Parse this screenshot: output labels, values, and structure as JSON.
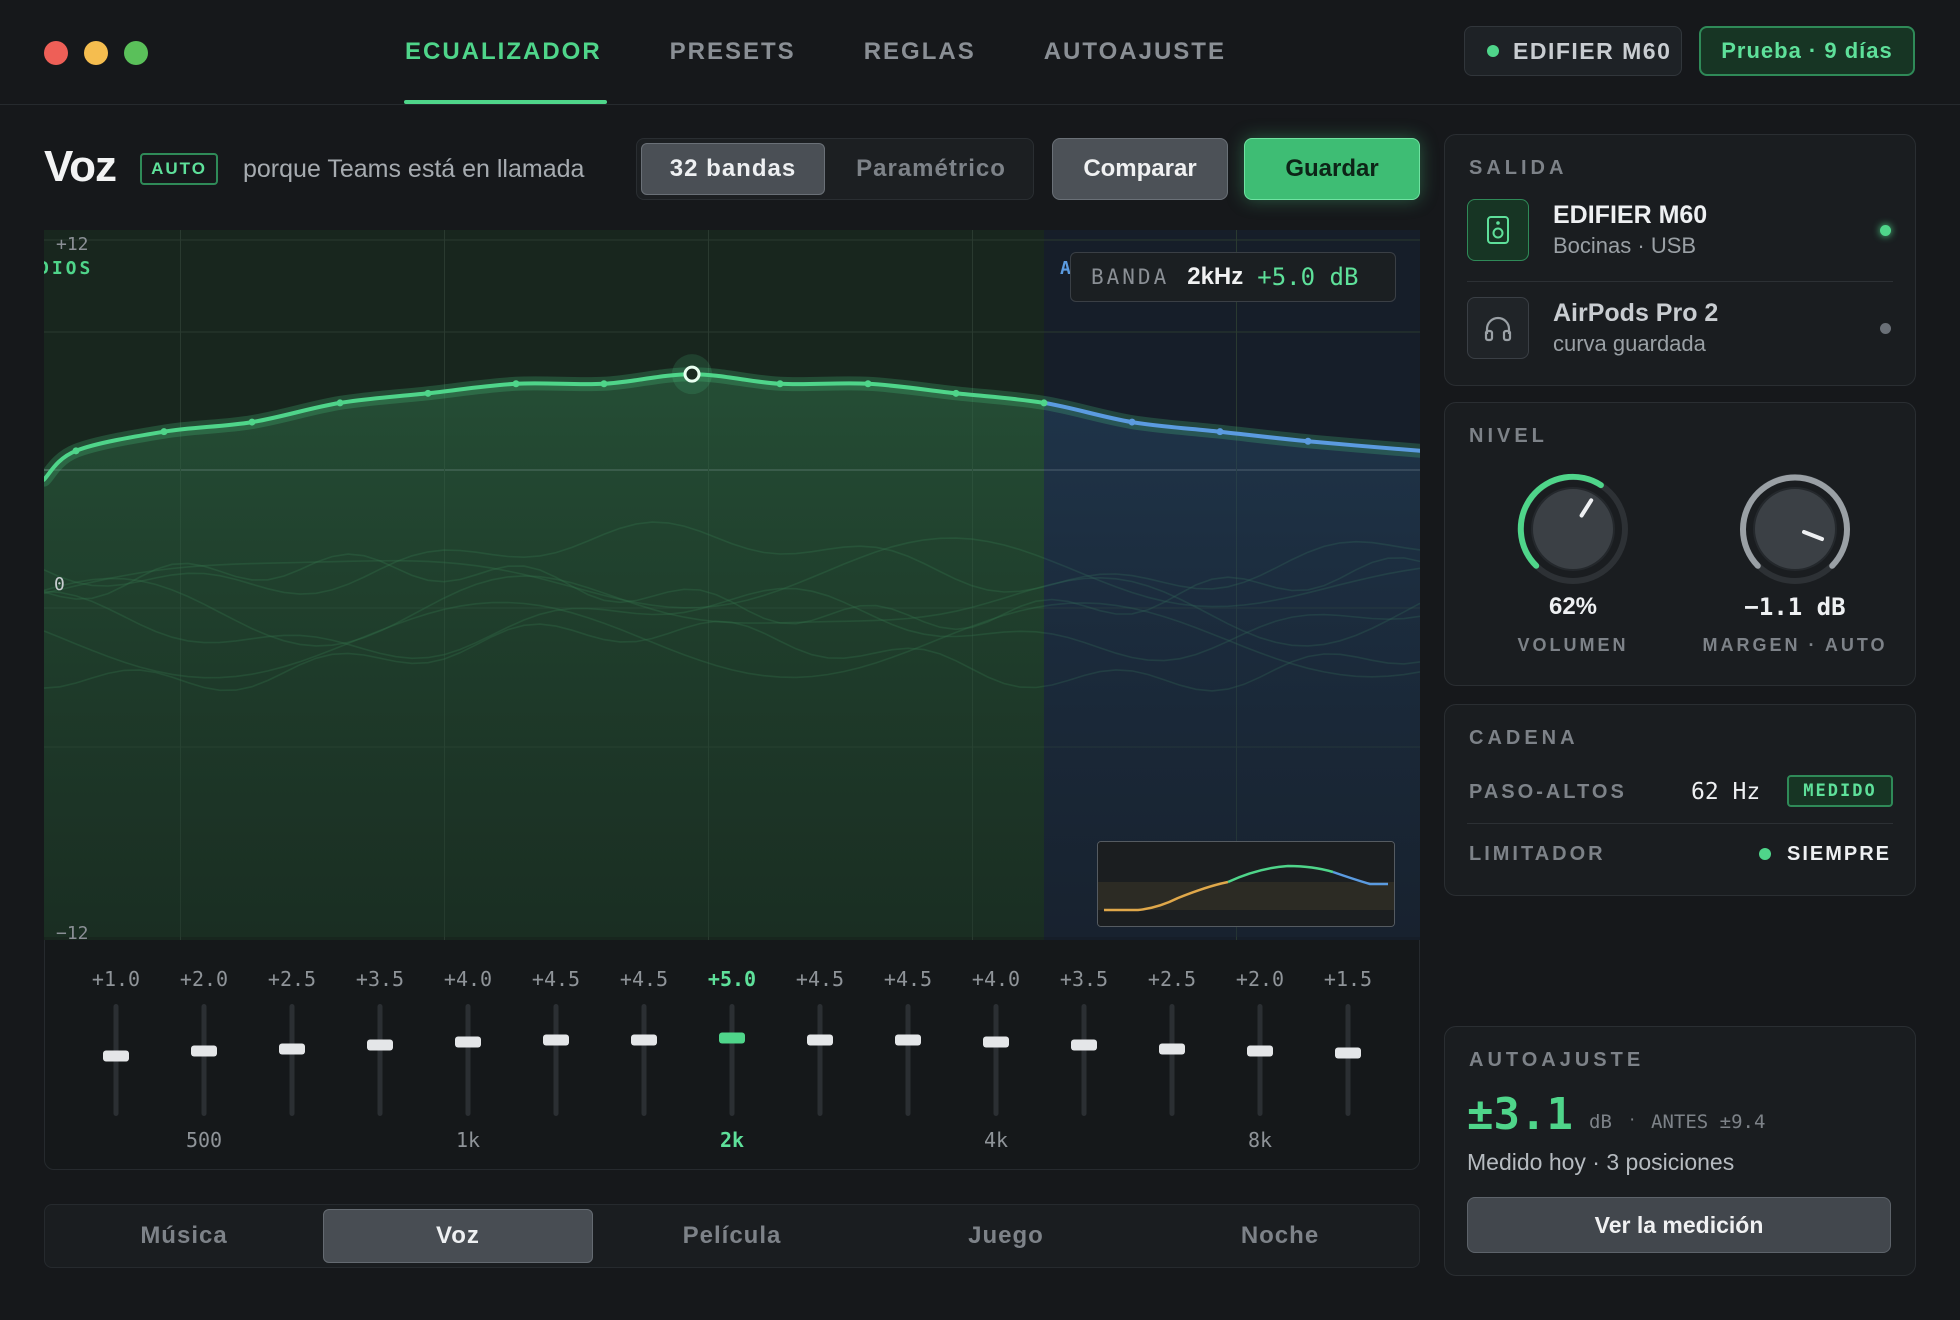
{
  "window": {
    "tabs": [
      {
        "label": "ECUALIZADOR",
        "active": true
      },
      {
        "label": "PRESETS",
        "active": false
      },
      {
        "label": "REGLAS",
        "active": false
      },
      {
        "label": "AUTOAJUSTE",
        "active": false
      }
    ],
    "device_pill": "EDIFIER M60",
    "trial_pill": "Prueba · 9 días"
  },
  "header": {
    "title": "Voz",
    "auto_badge": "AUTO",
    "reason": "porque Teams está en llamada",
    "mode_toggle": [
      {
        "label": "32 bandas",
        "active": true
      },
      {
        "label": "Paramétrico",
        "active": false
      }
    ],
    "compare_label": "Comparar",
    "save_label": "Guardar"
  },
  "eq": {
    "y_top_label": "+12",
    "y_zero_label": "0",
    "y_bottom_label": "−12",
    "left_region_label": "DIOS",
    "right_region_label": "A",
    "selected_band": {
      "label": "BANDA",
      "freq": "2kHz",
      "gain": "+5.0 dB"
    },
    "curve_gain_db": [
      -0.5,
      1.0,
      2.0,
      2.5,
      3.5,
      4.0,
      4.5,
      4.5,
      5.0,
      4.5,
      4.5,
      4.0,
      3.5,
      2.5,
      2.0,
      1.5,
      1.0
    ],
    "bands": [
      {
        "gain_label": "+1.0",
        "gain": 1.0,
        "selected": false
      },
      {
        "gain_label": "+2.0",
        "gain": 2.0,
        "selected": false
      },
      {
        "gain_label": "+2.5",
        "gain": 2.5,
        "selected": false
      },
      {
        "gain_label": "+3.5",
        "gain": 3.5,
        "selected": false
      },
      {
        "gain_label": "+4.0",
        "gain": 4.0,
        "selected": false
      },
      {
        "gain_label": "+4.5",
        "gain": 4.5,
        "selected": false
      },
      {
        "gain_label": "+4.5",
        "gain": 4.5,
        "selected": false
      },
      {
        "gain_label": "+5.0",
        "gain": 5.0,
        "selected": true
      },
      {
        "gain_label": "+4.5",
        "gain": 4.5,
        "selected": false
      },
      {
        "gain_label": "+4.5",
        "gain": 4.5,
        "selected": false
      },
      {
        "gain_label": "+4.0",
        "gain": 4.0,
        "selected": false
      },
      {
        "gain_label": "+3.5",
        "gain": 3.5,
        "selected": false
      },
      {
        "gain_label": "+2.5",
        "gain": 2.5,
        "selected": false
      },
      {
        "gain_label": "+2.0",
        "gain": 2.0,
        "selected": false
      },
      {
        "gain_label": "+1.5",
        "gain": 1.5,
        "selected": false
      }
    ],
    "freq_labels": [
      {
        "label": "500",
        "band": 1,
        "selected": false
      },
      {
        "label": "1k",
        "band": 4,
        "selected": false
      },
      {
        "label": "2k",
        "band": 7,
        "selected": true
      },
      {
        "label": "4k",
        "band": 10,
        "selected": false
      },
      {
        "label": "8k",
        "band": 13,
        "selected": false
      }
    ],
    "colors": {
      "accent": "#4fd58a",
      "secondary": "#5b9be0",
      "minimap_low": "#e0a84a"
    }
  },
  "presets": [
    {
      "label": "Música",
      "active": false
    },
    {
      "label": "Voz",
      "active": true
    },
    {
      "label": "Película",
      "active": false
    },
    {
      "label": "Juego",
      "active": false
    },
    {
      "label": "Noche",
      "active": false
    }
  ],
  "salida": {
    "heading": "SALIDA",
    "devices": [
      {
        "name": "EDIFIER M60",
        "sub": "Bocinas · USB",
        "icon": "speaker-icon",
        "active": true
      },
      {
        "name": "AirPods Pro 2",
        "sub": "curva guardada",
        "icon": "headphones-icon",
        "active": false
      }
    ]
  },
  "nivel": {
    "heading": "NIVEL",
    "volume": {
      "value": "62%",
      "label": "VOLUMEN",
      "fraction": 0.62
    },
    "margin": {
      "value": "−1.1 dB",
      "label": "MARGEN · AUTO"
    }
  },
  "cadena": {
    "heading": "CADENA",
    "highpass": {
      "label": "PASO-ALTOS",
      "value": "62 Hz",
      "badge": "MEDIDO"
    },
    "limiter": {
      "label": "LIMITADOR",
      "value": "SIEMPRE"
    }
  },
  "autoajuste": {
    "heading": "AUTOAJUSTE",
    "value": "±3.1",
    "unit": "dB",
    "before": "ANTES ±9.4",
    "measured": "Medido hoy · 3 posiciones",
    "button": "Ver la medición"
  }
}
